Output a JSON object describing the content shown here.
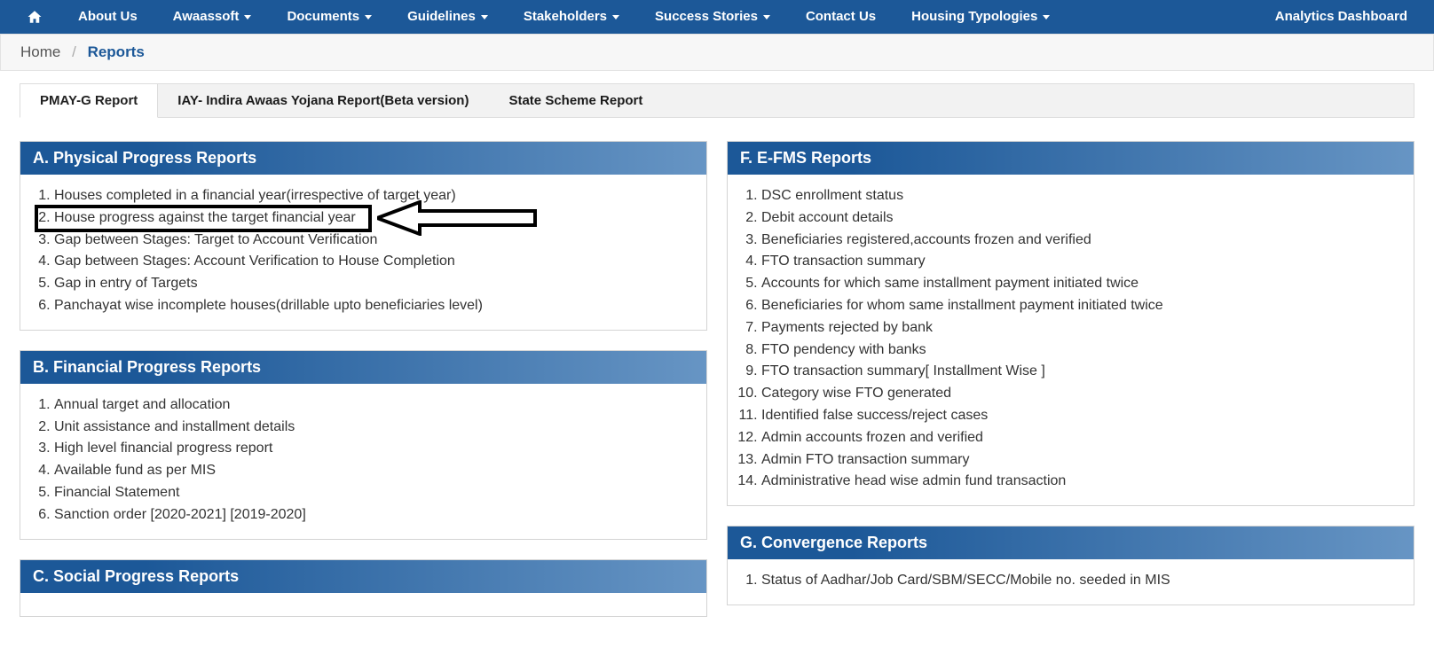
{
  "nav": {
    "items": [
      {
        "label": "About Us",
        "dropdown": false
      },
      {
        "label": "Awaassoft",
        "dropdown": true
      },
      {
        "label": "Documents",
        "dropdown": true
      },
      {
        "label": "Guidelines",
        "dropdown": true
      },
      {
        "label": "Stakeholders",
        "dropdown": true
      },
      {
        "label": "Success Stories",
        "dropdown": true
      },
      {
        "label": "Contact Us",
        "dropdown": false
      },
      {
        "label": "Housing Typologies",
        "dropdown": true
      }
    ],
    "right": "Analytics Dashboard"
  },
  "breadcrumb": {
    "home": "Home",
    "sep": "/",
    "current": "Reports"
  },
  "tabs": [
    {
      "label": "PMAY-G Report",
      "active": true
    },
    {
      "label": "IAY- Indira Awaas Yojana Report(Beta version)",
      "active": false
    },
    {
      "label": "State Scheme Report",
      "active": false
    }
  ],
  "left_panels": [
    {
      "title": "A. Physical Progress Reports",
      "items": [
        "Houses completed in a financial year(irrespective of target year)",
        "House progress against the target financial year",
        "Gap between Stages: Target to Account Verification",
        "Gap between Stages: Account Verification to House Completion",
        "Gap in entry of Targets",
        "Panchayat wise incomplete houses(drillable upto beneficiaries level)"
      ],
      "highlight_index": 1
    },
    {
      "title": "B. Financial Progress Reports",
      "items": [
        "Annual target and allocation",
        "Unit assistance and installment details",
        "High level financial progress report",
        "Available fund as per MIS",
        "Financial Statement",
        "Sanction order [2020-2021] [2019-2020]"
      ]
    },
    {
      "title": "C. Social Progress Reports",
      "items": []
    }
  ],
  "right_panels": [
    {
      "title": "F. E-FMS Reports",
      "items": [
        "DSC enrollment status",
        "Debit account details",
        "Beneficiaries registered,accounts frozen and verified",
        "FTO transaction summary",
        "Accounts for which same installment payment initiated twice",
        "Beneficiaries for whom same installment payment initiated twice",
        "Payments rejected by bank",
        "FTO pendency with banks",
        "FTO transaction summary[ Installment Wise ]",
        "Category wise FTO generated",
        "Identified false success/reject cases",
        "Admin accounts frozen and verified",
        "Admin FTO transaction summary",
        "Administrative head wise admin fund transaction"
      ]
    },
    {
      "title": "G. Convergence Reports",
      "items": [
        "Status of Aadhar/Job Card/SBM/SECC/Mobile no. seeded in MIS"
      ]
    }
  ]
}
